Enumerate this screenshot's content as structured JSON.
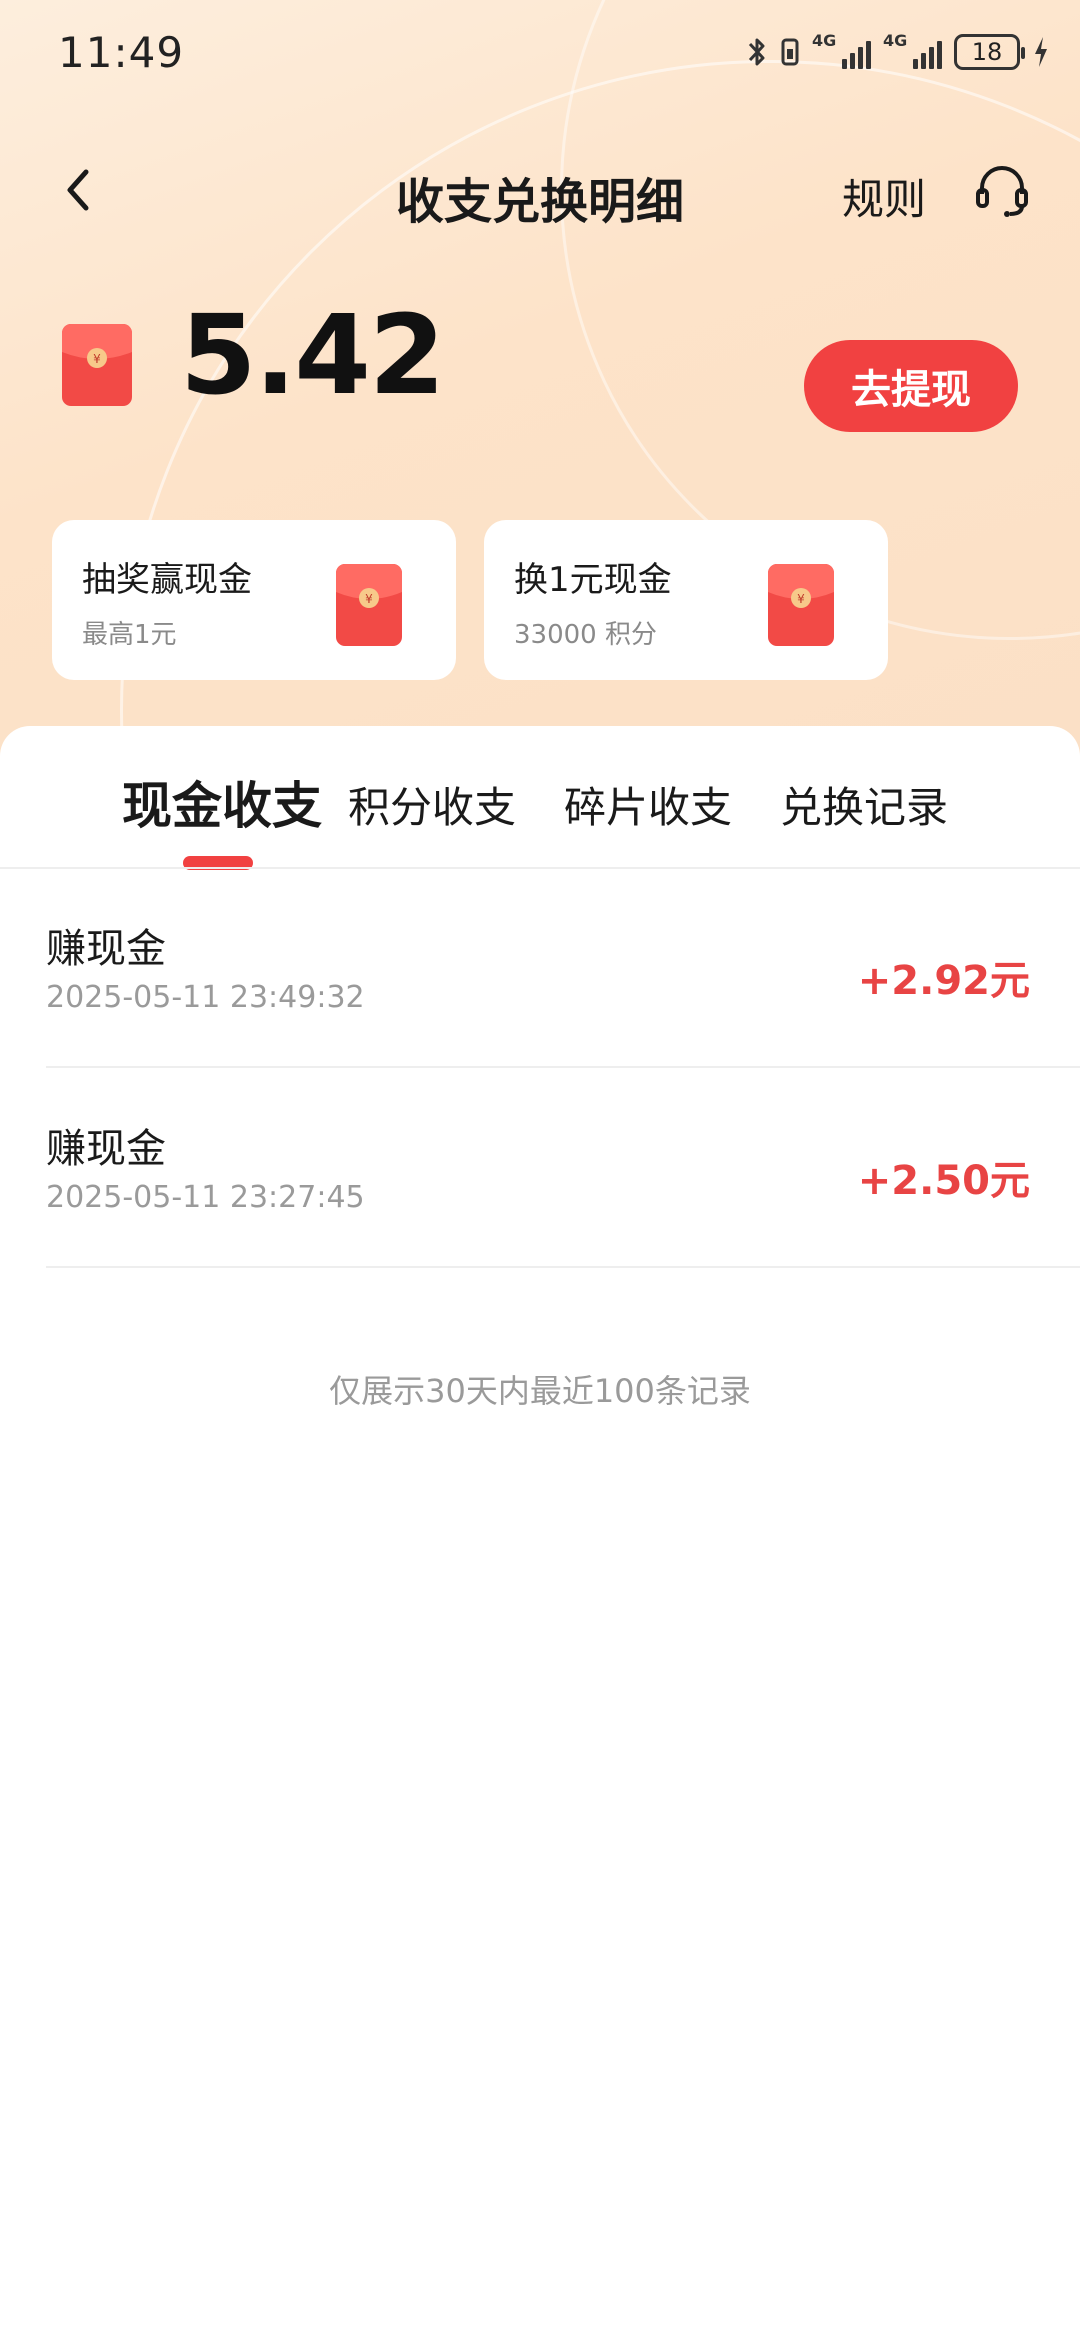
{
  "status_bar": {
    "time": "11:49",
    "signal1_label": "4G",
    "signal2_label": "4G",
    "battery": "18"
  },
  "header": {
    "title": "收支兑换明细",
    "rules_label": "规则"
  },
  "balance": {
    "value": "5.42",
    "withdraw_label": "去提现"
  },
  "promo_cards": [
    {
      "title": "抽奖赢现金",
      "subtitle": "最高1元"
    },
    {
      "title": "换1元现金",
      "subtitle": "33000 积分"
    }
  ],
  "tabs": [
    {
      "label": "现金收支",
      "active": true
    },
    {
      "label": "积分收支",
      "active": false
    },
    {
      "label": "碎片收支",
      "active": false
    },
    {
      "label": "兑换记录",
      "active": false
    }
  ],
  "records": [
    {
      "title": "赚现金",
      "time": "2025-05-11 23:49:32",
      "amount": "+2.92元"
    },
    {
      "title": "赚现金",
      "time": "2025-05-11 23:27:45",
      "amount": "+2.50元"
    }
  ],
  "footer_note": "仅展示30天内最近100条记录",
  "colors": {
    "accent": "#f14141",
    "amount": "#e84444",
    "header_bg": "#fde3c9"
  },
  "icons": {
    "back": "back-arrow-icon",
    "service": "headset-icon",
    "red_envelope": "red-envelope-icon"
  }
}
